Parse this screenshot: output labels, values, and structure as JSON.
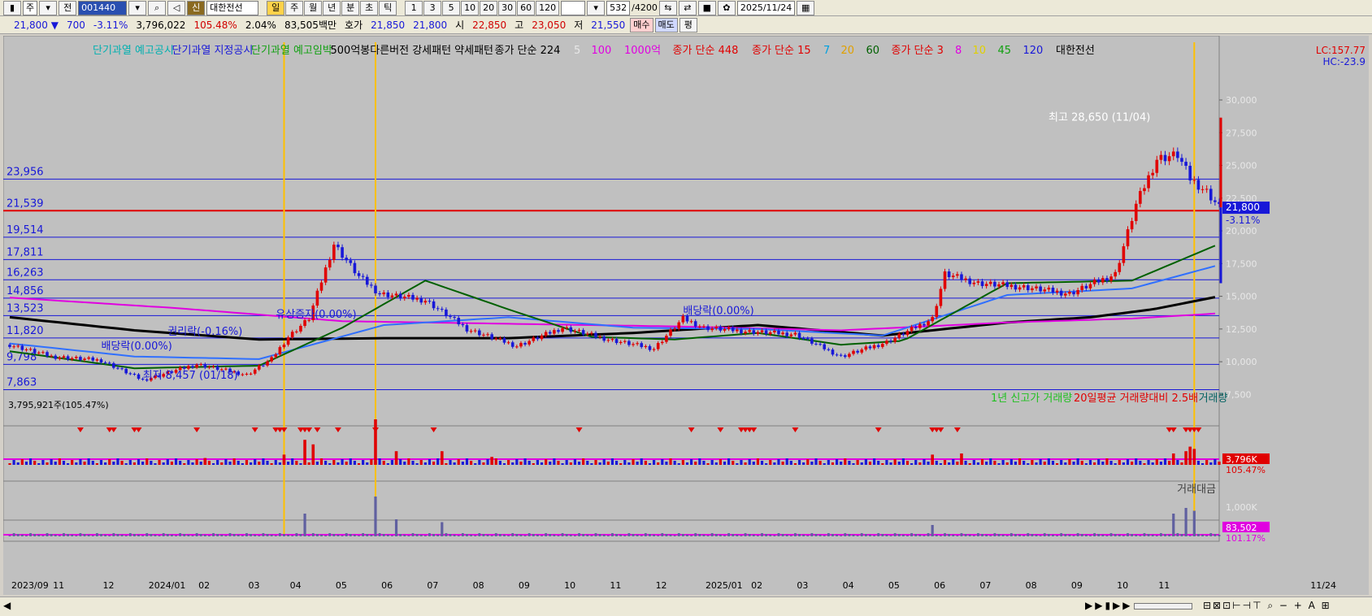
{
  "toolbar": {
    "period_select": "주",
    "mode_label": "전",
    "code": "001440",
    "stock_badge": "신",
    "stock_name": "대한전선",
    "timeframes": [
      "일",
      "주",
      "월",
      "년",
      "분",
      "초",
      "틱"
    ],
    "active_timeframe": "일",
    "intervals": [
      "1",
      "3",
      "5",
      "10",
      "20",
      "30",
      "60",
      "120"
    ],
    "count": "532",
    "count_total": "/4200",
    "date": "2025/11/24"
  },
  "quote": {
    "price": "21,800",
    "direction": "▼",
    "change": "700",
    "change_pct": "-3.11%",
    "volume": "3,796,022",
    "volume_ratio": "105.48%",
    "turnover": "2.04%",
    "amount": "83,505백만",
    "bid_label": "호가",
    "ask": "21,850",
    "bid": "21,800",
    "open_label": "시",
    "open": "22,850",
    "high_label": "고",
    "high": "23,050",
    "low_label": "저",
    "low": "21,550",
    "buy_button": "매수",
    "sell_button": "매도",
    "eval_button": "평"
  },
  "chart_data": {
    "type": "line",
    "title": "대한전선",
    "legend_items": [
      {
        "text": "단기과열 예고공시",
        "color": "#00b0b0"
      },
      {
        "text": "단기과열 지정공시",
        "color": "#1818d8"
      },
      {
        "text": "단기과열 예고임박",
        "color": "#10a010"
      },
      {
        "text": "500억봉다른버전 강세패턴  약세패턴",
        "color": "#000000"
      },
      {
        "text": "종가 단순 224",
        "color": "#000000"
      },
      {
        "text": "5",
        "color": "#e8e8e8"
      },
      {
        "text": "100",
        "color": "#e000e0"
      },
      {
        "text": "1000억",
        "color": "#e000e0"
      },
      {
        "text": "종가 단순 448",
        "color": "#e00000"
      },
      {
        "text": "종가 단순 15",
        "color": "#e00000"
      },
      {
        "text": "7",
        "color": "#00a0e0"
      },
      {
        "text": "20",
        "color": "#e0a000"
      },
      {
        "text": "60",
        "color": "#006000"
      },
      {
        "text": "종가 단순 3",
        "color": "#e00000"
      },
      {
        "text": "8",
        "color": "#e000e0"
      },
      {
        "text": "10",
        "color": "#e0d000"
      },
      {
        "text": "45",
        "color": "#10a010"
      },
      {
        "text": "120",
        "color": "#1818d8"
      },
      {
        "text": "대한전선",
        "color": "#000000"
      }
    ],
    "lc_label": "LC:157.77",
    "hc_label": "HC:-23.9",
    "y_axis": {
      "ticks": [
        7500,
        10000,
        12500,
        15000,
        17500,
        20000,
        22500,
        25000,
        27500,
        30000
      ],
      "tick_labels": [
        "7,500",
        "10,000",
        "12,500",
        "15,000",
        "17,500",
        "20,000",
        "22,500",
        "25,000",
        "27,500",
        "30,000"
      ],
      "ylim": [
        5600,
        31800
      ]
    },
    "x_axis": {
      "labels": [
        "2023/09",
        "11",
        "12",
        "2024/01",
        "02",
        "03",
        "04",
        "05",
        "06",
        "07",
        "08",
        "09",
        "10",
        "11",
        "12",
        "2025/01",
        "02",
        "03",
        "04",
        "05",
        "06",
        "07",
        "08",
        "09",
        "10",
        "11"
      ],
      "positions": [
        0,
        10,
        22,
        33,
        45,
        57,
        67,
        78,
        89,
        100,
        111,
        122,
        133,
        144,
        155,
        167,
        178,
        189,
        200,
        211,
        222,
        233,
        244,
        255,
        266,
        276
      ],
      "total": 291,
      "last_label": "11/24"
    },
    "horizontal_levels": [
      {
        "label": "23,956",
        "value": 23956
      },
      {
        "label": "21,539",
        "value": 21539
      },
      {
        "label": "19,514",
        "value": 19514
      },
      {
        "label": "17,811",
        "value": 17811
      },
      {
        "label": "16,263",
        "value": 16263
      },
      {
        "label": "14,856",
        "value": 14856
      },
      {
        "label": "13,523",
        "value": 13523
      },
      {
        "label": "11,820",
        "value": 11820
      },
      {
        "label": "9,798",
        "value": 9798
      },
      {
        "label": "7,863",
        "value": 7863
      }
    ],
    "current_price": {
      "label": "21,800",
      "pct": "-3.11%",
      "value": 21800
    },
    "annotations": [
      {
        "text": "최고 28,650 (11/04)",
        "x": 276,
        "y": 28650
      },
      {
        "text": "최저 8,457 (01/18)",
        "x": 32,
        "y": 8457
      },
      {
        "text": "권리락(-0.16%)",
        "x": 38,
        "y": 11800
      },
      {
        "text": "배당락(0.00%)",
        "x": 22,
        "y": 10700
      },
      {
        "text": "유상증자(0.00%)",
        "x": 64,
        "y": 13100
      },
      {
        "text": "배당락(0.00%)",
        "x": 162,
        "y": 13400
      }
    ],
    "vertical_markers": [
      66,
      88,
      285
    ],
    "price_series": {
      "name": "대한전선",
      "x": [
        0,
        10,
        22,
        32,
        45,
        57,
        63,
        67,
        72,
        78,
        84,
        89,
        100,
        110,
        122,
        133,
        144,
        155,
        162,
        167,
        178,
        189,
        200,
        211,
        222,
        225,
        233,
        244,
        255,
        266,
        271,
        276,
        279,
        281,
        284,
        288,
        291
      ],
      "close": [
        11300,
        10400,
        10100,
        8600,
        9800,
        9000,
        10200,
        11900,
        13300,
        19000,
        16500,
        15200,
        14700,
        12500,
        11200,
        12600,
        11700,
        11000,
        13300,
        12600,
        12300,
        12100,
        10400,
        11500,
        13300,
        16700,
        16000,
        15700,
        15200,
        16700,
        22000,
        25500,
        25700,
        25800,
        24000,
        23000,
        21800
      ]
    },
    "ma_series": [
      {
        "label": "224",
        "color": "#000000",
        "x": [
          0,
          30,
          60,
          90,
          120,
          150,
          180,
          210,
          240,
          260,
          275,
          291
        ],
        "values": [
          13400,
          12400,
          11700,
          11800,
          11800,
          12200,
          12800,
          12000,
          13000,
          13400,
          14000,
          15000
        ]
      },
      {
        "label": "448",
        "color": "#e000e0",
        "x": [
          0,
          40,
          80,
          120,
          160,
          200,
          240,
          270,
          291
        ],
        "values": [
          14900,
          14100,
          13100,
          12900,
          12700,
          12400,
          13000,
          13300,
          13700
        ]
      },
      {
        "label": "120",
        "color": "#3070ff",
        "x": [
          0,
          30,
          60,
          90,
          120,
          150,
          180,
          210,
          240,
          270,
          291
        ],
        "values": [
          11400,
          10400,
          10200,
          12800,
          13400,
          12600,
          12500,
          12000,
          15100,
          15600,
          17400
        ]
      },
      {
        "label": "60",
        "color": "#006000",
        "x": [
          0,
          30,
          60,
          80,
          100,
          120,
          140,
          160,
          180,
          200,
          215,
          240,
          270,
          291
        ],
        "values": [
          10800,
          9500,
          9700,
          12600,
          16200,
          14000,
          11900,
          11700,
          12200,
          11300,
          11600,
          16000,
          16200,
          19000
        ]
      }
    ],
    "volume_panel": {
      "label": "3,795,921주(105.47%)",
      "legend": [
        {
          "text": "1년 신고가 거래량",
          "color": "#20c020"
        },
        {
          "text": "20일평균 거래량대비 2.5배",
          "color": "#e00000"
        },
        {
          "text": "거래량",
          "color": "#006060"
        }
      ],
      "current_label": "3,796K",
      "current_pct": "105.47%",
      "spikes_x": [
        47,
        66,
        71,
        73,
        88,
        93,
        104,
        116,
        222,
        229,
        280,
        283,
        284,
        285
      ],
      "spikes_v": [
        3.0,
        4.5,
        11.0,
        9.0,
        20.0,
        6.0,
        6.0,
        3.5,
        4.5,
        5.0,
        5.0,
        6.0,
        8.0,
        7.0
      ],
      "marker_x": [
        17,
        24,
        25,
        30,
        31,
        45,
        59,
        64,
        65,
        66,
        70,
        71,
        72,
        74,
        79,
        88,
        102,
        137,
        164,
        171,
        176,
        177,
        178,
        179,
        189,
        209,
        222,
        223,
        224,
        228,
        279,
        280,
        283,
        284,
        285,
        286
      ]
    },
    "amount_panel": {
      "label": "거래대금",
      "tick_label": "1,000K",
      "current_label": "83,502",
      "current_pct": "101.17%",
      "spikes_x": [
        71,
        88,
        93,
        104,
        222,
        280,
        283,
        285
      ],
      "spikes_v": [
        4.0,
        7.0,
        3.0,
        2.5,
        2.0,
        4.0,
        5.0,
        4.5
      ]
    }
  }
}
